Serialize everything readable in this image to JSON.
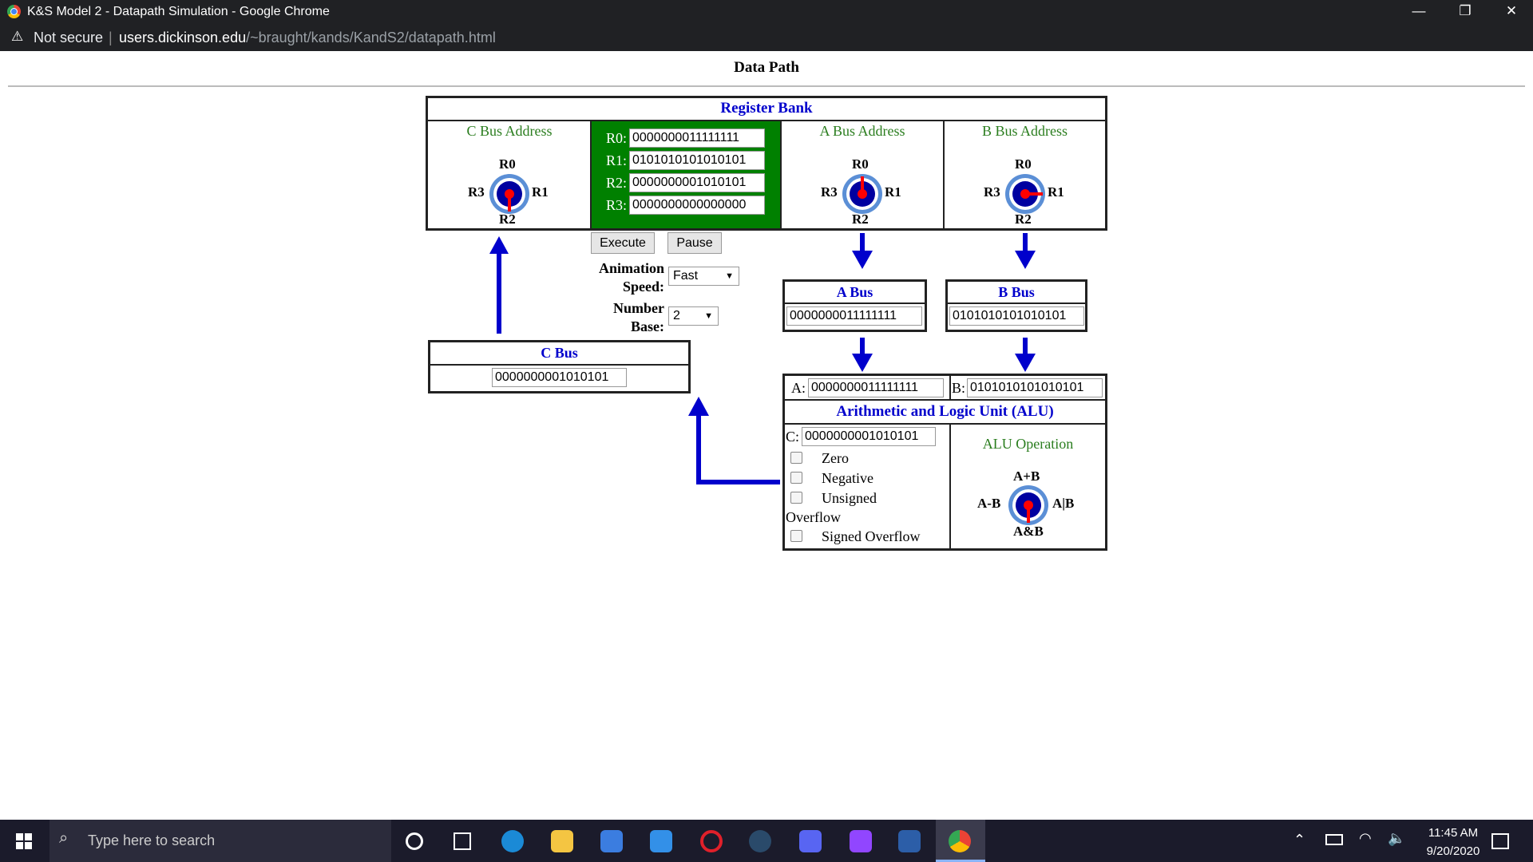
{
  "browser": {
    "window_title": "K&S Model 2 - Datapath Simulation - Google Chrome",
    "security_label": "Not secure",
    "url_host": "users.dickinson.edu",
    "url_path": "/~braught/kands/KandS2/datapath.html",
    "minimize": "—",
    "restore": "❐",
    "close": "✕"
  },
  "page": {
    "title": "Data Path"
  },
  "register_bank": {
    "title": "Register Bank",
    "c_bus_address_label": "C Bus Address",
    "a_bus_address_label": "A Bus Address",
    "b_bus_address_label": "B Bus Address",
    "registers": [
      {
        "name": "R0:",
        "value": "0000000011111111"
      },
      {
        "name": "R1:",
        "value": "0101010101010101"
      },
      {
        "name": "R2:",
        "value": "0000000001010101"
      },
      {
        "name": "R3:",
        "value": "0000000000000000"
      }
    ],
    "dial_labels": {
      "top": "R0",
      "right": "R1",
      "bottom": "R2",
      "left": "R3"
    }
  },
  "controls": {
    "execute": "Execute",
    "pause": "Pause",
    "animation_speed_label_1": "Animation",
    "animation_speed_label_2": "Speed:",
    "animation_speed_value": "Fast",
    "number_base_label_1": "Number",
    "number_base_label_2": "Base:",
    "number_base_value": "2"
  },
  "a_bus": {
    "title": "A Bus",
    "value": "0000000011111111"
  },
  "b_bus": {
    "title": "B Bus",
    "value": "0101010101010101"
  },
  "c_bus": {
    "title": "C Bus",
    "value": "0000000001010101"
  },
  "alu": {
    "title": "Arithmetic and Logic Unit (ALU)",
    "a_label": "A:",
    "a_value": "0000000011111111",
    "b_label": "B:",
    "b_value": "0101010101010101",
    "c_label": "C:",
    "c_value": "0000000001010101",
    "flags": [
      "Zero",
      "Negative",
      "Unsigned",
      "Signed Overflow"
    ],
    "overflow_word": "Overflow",
    "operation_label": "ALU Operation",
    "op_labels": {
      "top": "A+B",
      "right": "A|B",
      "bottom": "A&B",
      "left": "A-B"
    }
  },
  "taskbar": {
    "search_placeholder": "Type here to search",
    "time": "11:45 AM",
    "date": "9/20/2020"
  },
  "colors": {
    "accent_blue": "#0000cc",
    "register_green": "#008000",
    "label_green": "#2a7d1e",
    "pointer_red": "#ff0000"
  }
}
